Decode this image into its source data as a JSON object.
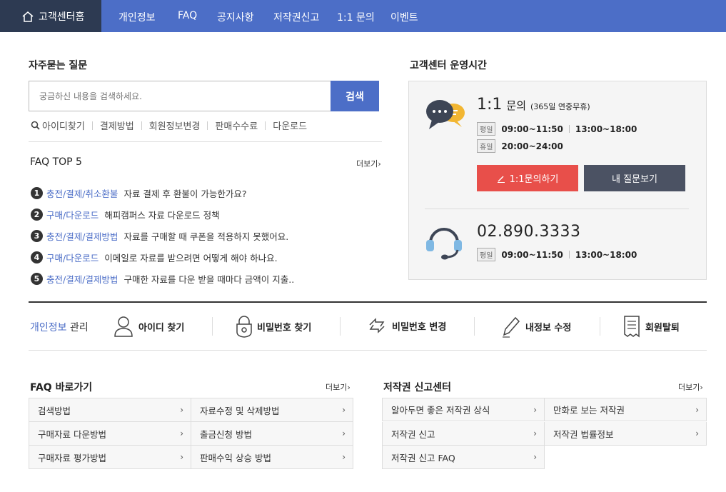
{
  "nav": {
    "home": "고객센터홈",
    "items": [
      "개인정보",
      "FAQ",
      "공지사항",
      "저작권신고",
      "1:1 문의",
      "이벤트"
    ]
  },
  "faq_search": {
    "title": "자주묻는 질문",
    "placeholder": "궁금하신 내용을 검색하세요.",
    "button": "검색",
    "quick_links": [
      "아이디찾기",
      "결제방법",
      "회원정보변경",
      "판매수수료",
      "다운로드"
    ]
  },
  "faq_top5": {
    "title": "FAQ TOP 5",
    "more": "더보기",
    "items": [
      {
        "num": "1",
        "category": "충전/결제/취소환불",
        "question": "자료 결제 후 환불이 가능한가요?"
      },
      {
        "num": "2",
        "category": "구매/다운로드",
        "question": "해피캠퍼스 자료 다운로드 정책"
      },
      {
        "num": "3",
        "category": "충전/결제/결제방법",
        "question": "자료를 구매할 때 쿠폰을 적용하지 못했어요."
      },
      {
        "num": "4",
        "category": "구매/다운로드",
        "question": "이메일로 자료를 받으려면 어떻게 해야 하나요."
      },
      {
        "num": "5",
        "category": "충전/결제/결제방법",
        "question": "구매한 자료를 다운 받을 때마다 금액이 지출.."
      }
    ]
  },
  "hours": {
    "title": "고객센터 운영시간",
    "chat_big": "1:1",
    "chat_mid": "문의",
    "chat_small": "(365일 연중무휴)",
    "weekday_tag": "평일",
    "weekday_time1": "09:00~11:50",
    "weekday_time2": "13:00~18:00",
    "holiday_tag": "휴일",
    "holiday_time": "20:00~24:00",
    "ask_button": "1:1문의하기",
    "my_questions_button": "내 질문보기",
    "phone": "02.890.3333",
    "phone_tag": "평일",
    "phone_time1": "09:00~11:50",
    "phone_time2": "13:00~18:00"
  },
  "personal": {
    "title_blue": "개인정보",
    "title_rest": " 관리",
    "items": [
      "아이디 찾기",
      "비밀번호 찾기",
      "비밀번호 변경",
      "내정보 수정",
      "회원탈퇴"
    ]
  },
  "faq_shortcuts": {
    "title": "FAQ 바로가기",
    "more": "더보기",
    "left": [
      "검색방법",
      "구매자료 다운방법",
      "구매자료 평가방법"
    ],
    "right": [
      "자료수정 및 삭제방법",
      "출금신청 방법",
      "판매수익 상승 방법"
    ]
  },
  "copyright": {
    "title": "저작권 신고센터",
    "more": "더보기",
    "left": [
      "알아두면 좋은 저작권 상식",
      "저작권 신고",
      "저작권 신고 FAQ"
    ],
    "right": [
      "만화로 보는 저작권",
      "저작권 법률정보"
    ]
  },
  "colors": {
    "accent": "#4c6ec7",
    "dark_nav": "#2d3a52",
    "red": "#e84f4a",
    "dark_button": "#4b5263"
  }
}
